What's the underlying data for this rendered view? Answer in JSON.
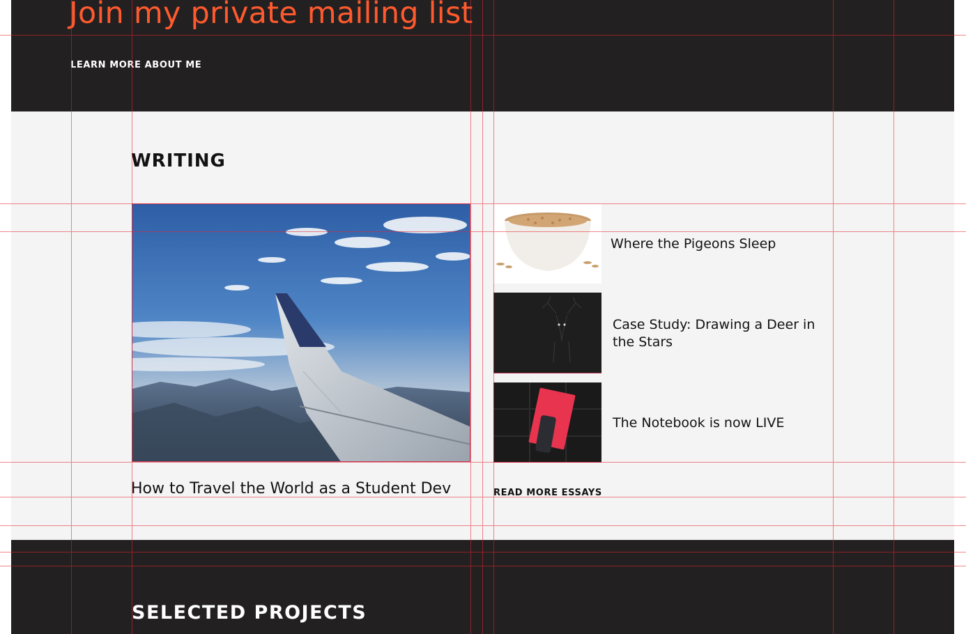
{
  "hero": {
    "title": "Join my private mailing list",
    "learn_more": "LEARN MORE ABOUT ME"
  },
  "writing": {
    "heading": "WRITING",
    "featured": {
      "title": "How to Travel the World as a Student Dev",
      "image": "airplane-wing-over-mountains"
    },
    "essays": [
      {
        "title": "Where the Pigeons Sleep",
        "image": "bowl-of-oats"
      },
      {
        "title": "Case Study: Drawing a Deer in the Stars",
        "image": "deer-constellation"
      },
      {
        "title": "The Notebook is now LIVE",
        "image": "red-notebook-and-phone"
      }
    ],
    "read_more": "READ MORE ESSAYS"
  },
  "projects": {
    "heading": "SELECTED PROJECTS"
  },
  "colors": {
    "dark_band": "#222021",
    "light_band": "#f4f4f4",
    "accent": "#ff5a2d",
    "guide_line": "#e8242e"
  }
}
